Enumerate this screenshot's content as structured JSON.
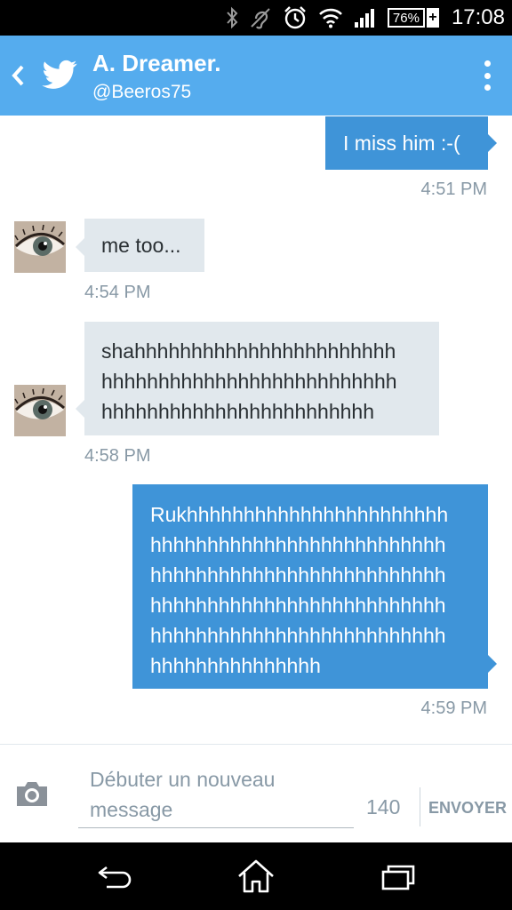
{
  "status_bar": {
    "battery_percent": "76%",
    "time": "17:08",
    "icons": [
      "bluetooth-icon",
      "hearing-aid-icon",
      "alarm-icon",
      "wifi-icon",
      "signal-icon",
      "battery-icon"
    ]
  },
  "header": {
    "contact_name": "A. Dreamer.",
    "contact_handle": "@Beeros75",
    "accent_color": "#55acee"
  },
  "messages": [
    {
      "direction": "sent",
      "text": "I miss him :-(",
      "time": "4:51 PM"
    },
    {
      "direction": "received",
      "text": "me too...",
      "time": "4:54 PM"
    },
    {
      "direction": "received",
      "lines": [
        "shahhhhhhhhhhhhhhhhhhhhhhh",
        "hhhhhhhhhhhhhhhhhhhhhhhhhh",
        "hhhhhhhhhhhhhhhhhhhhhhhh"
      ],
      "time": "4:58 PM"
    },
    {
      "direction": "sent",
      "lines": [
        "Rukhhhhhhhhhhhhhhhhhhhhhhh",
        "hhhhhhhhhhhhhhhhhhhhhhhhhh",
        "hhhhhhhhhhhhhhhhhhhhhhhhhh",
        "hhhhhhhhhhhhhhhhhhhhhhhhhh",
        "hhhhhhhhhhhhhhhhhhhhhhhhhh",
        "hhhhhhhhhhhhhhh"
      ],
      "time": "4:59 PM"
    }
  ],
  "composer": {
    "placeholder_line1": "Débuter un nouveau",
    "placeholder_line2": "message",
    "char_count": "140",
    "send_label": "ENVOYER"
  },
  "colors": {
    "sent_bubble": "#3f94d8",
    "received_bubble": "#e1e8ed",
    "timestamp": "#8899a6"
  },
  "nav_bar": {
    "buttons": [
      "back-nav-icon",
      "home-icon",
      "recent-apps-icon"
    ]
  }
}
